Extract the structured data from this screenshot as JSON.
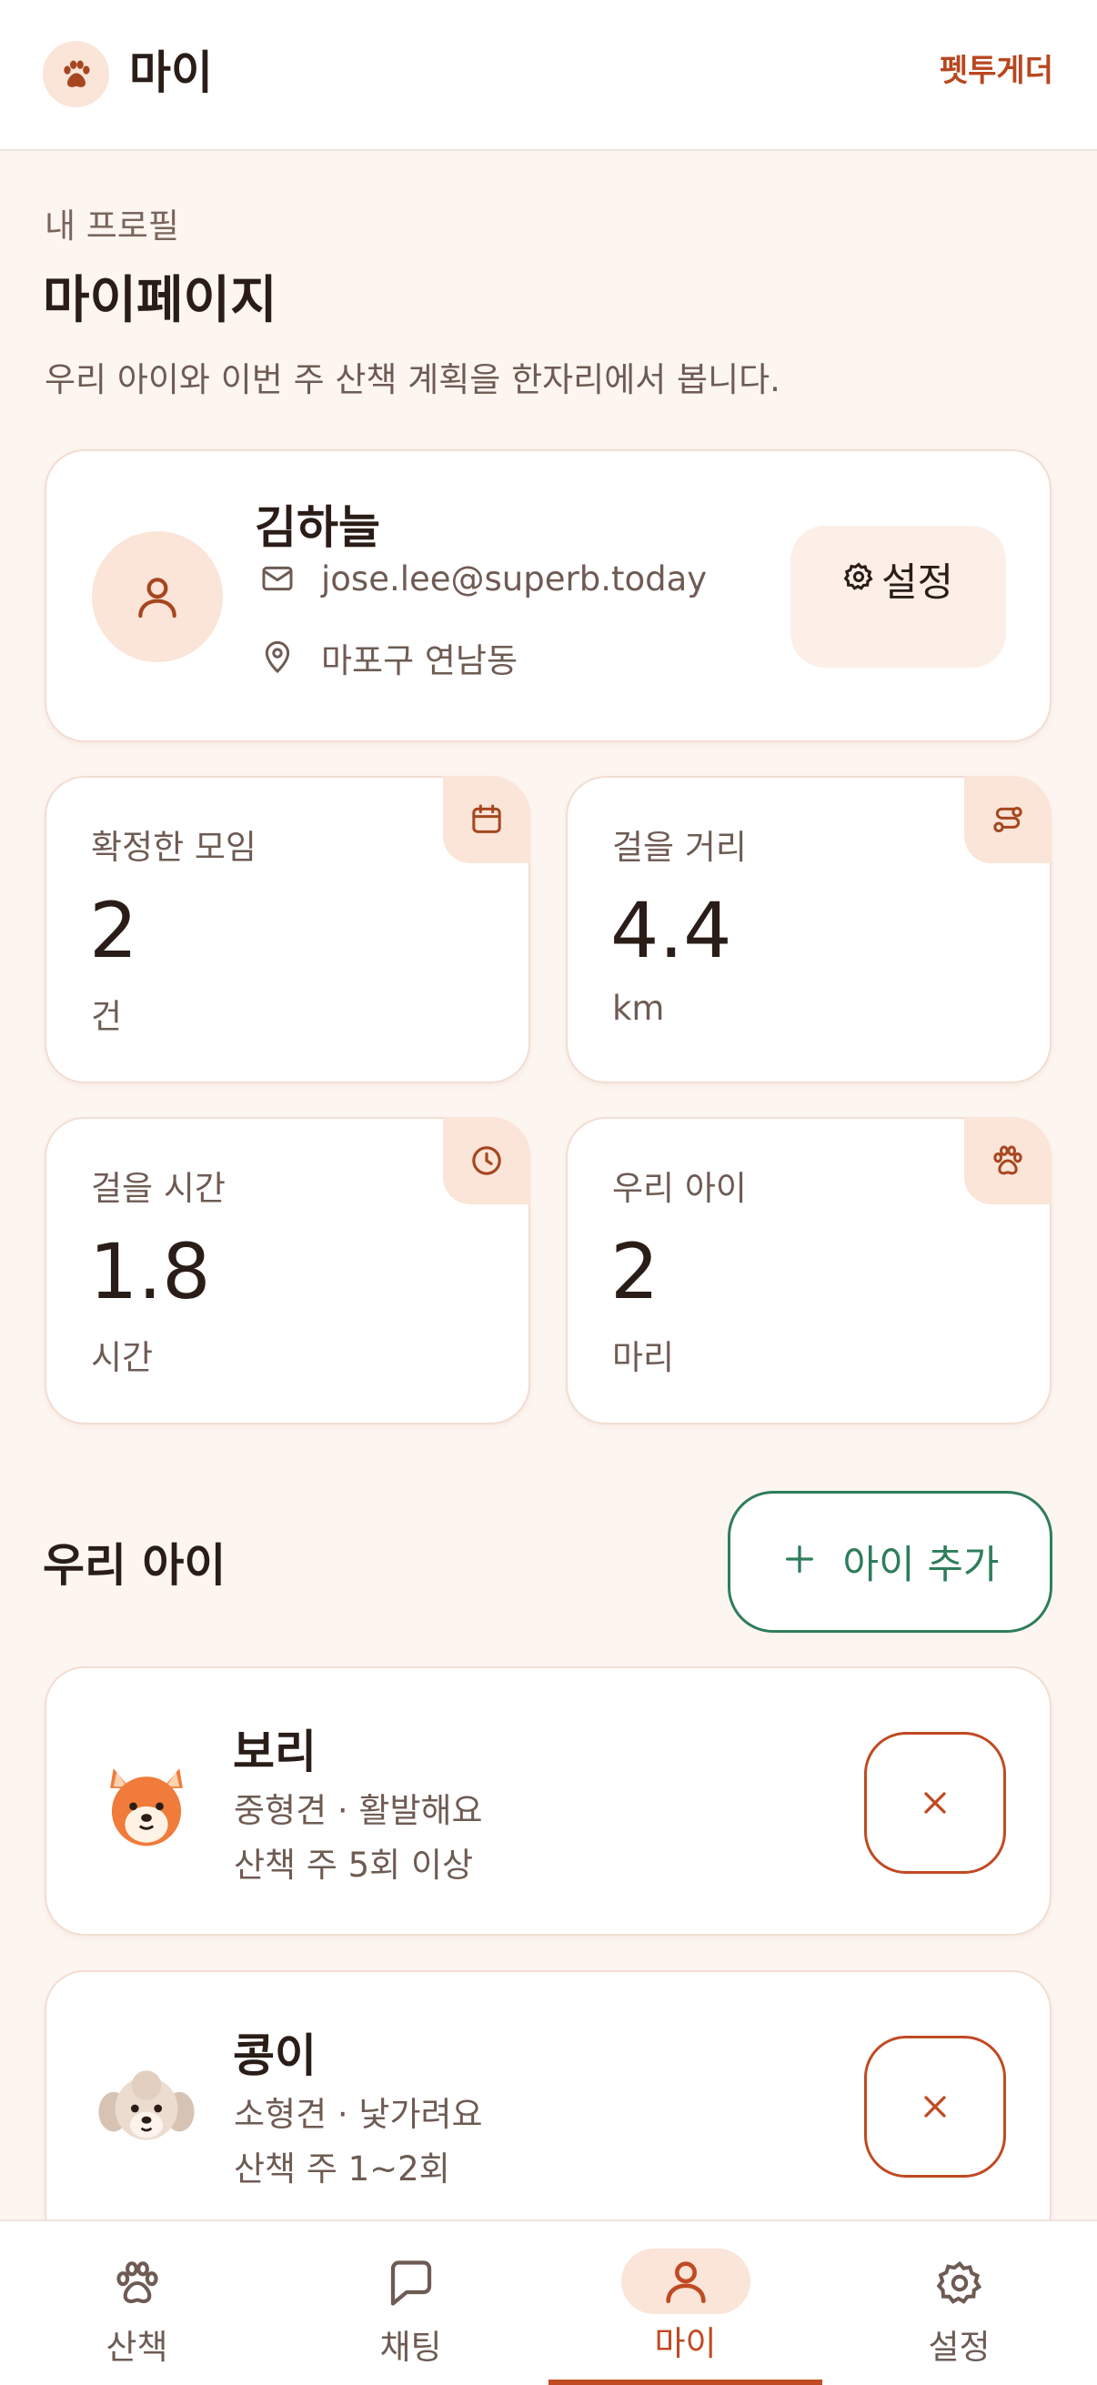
{
  "header": {
    "title": "마이",
    "brand": "펫투게더"
  },
  "page": {
    "eyebrow": "내 프로필",
    "title": "마이페이지",
    "subtitle": "우리 아이와 이번 주 산책 계획을 한자리에서 봅니다."
  },
  "profile": {
    "name": "김하늘",
    "email": "jose.lee@superb.today",
    "location": "마포구 연남동",
    "settings_label": "설정"
  },
  "stats": [
    {
      "label": "확정한 모임",
      "value": "2",
      "unit": "건",
      "icon": "calendar-icon"
    },
    {
      "label": "걸을 거리",
      "value": "4.4",
      "unit": "km",
      "icon": "route-icon"
    },
    {
      "label": "걸을 시간",
      "value": "1.8",
      "unit": "시간",
      "icon": "clock-icon"
    },
    {
      "label": "우리 아이",
      "value": "2",
      "unit": "마리",
      "icon": "paw-icon"
    }
  ],
  "pets_section": {
    "title": "우리 아이",
    "add_label": "아이 추가"
  },
  "pets": [
    {
      "name": "보리",
      "desc": "중형견 · 활발해요",
      "walk": "산책 주 5회 이상",
      "avatar": "shiba-dog-icon"
    },
    {
      "name": "콩이",
      "desc": "소형견 · 낯가려요",
      "walk": "산책 주 1~2회",
      "avatar": "poodle-dog-icon"
    }
  ],
  "nav": [
    {
      "label": "산책",
      "icon": "paw-icon"
    },
    {
      "label": "채팅",
      "icon": "chat-icon"
    },
    {
      "label": "마이",
      "icon": "user-icon",
      "active": true
    },
    {
      "label": "설정",
      "icon": "gear-icon"
    }
  ],
  "colors": {
    "accent": "#c04a22",
    "accent_soft": "#fbe4d8",
    "green": "#2e7d5b",
    "background": "#fdf5f0"
  }
}
